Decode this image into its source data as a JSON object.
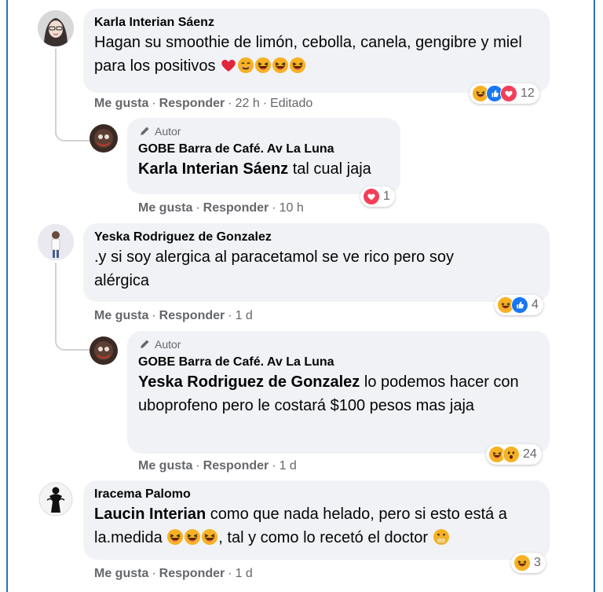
{
  "comments": [
    {
      "author": "Karla Interian Sáenz",
      "text": "Hagan su smoothie de limón, cebolla, canela, gengibre y miel para los positivos",
      "emojis": [
        "red-heart",
        "smiling-face",
        "laughing-face",
        "laughing-face",
        "laughing-face"
      ],
      "like": "Me gusta",
      "reply": "Responder",
      "time": "22 h",
      "edited": "Editado",
      "reaction_count": "12",
      "reactions": [
        "haha",
        "like",
        "love"
      ]
    },
    {
      "badge": "Autor",
      "author": "GOBE Barra de Café. Av La Luna",
      "mention": "Karla Interian Sáenz",
      "text": " tal cual jaja",
      "like": "Me gusta",
      "reply": "Responder",
      "time": "10 h",
      "reaction_count": "1",
      "reactions": [
        "love"
      ]
    },
    {
      "author": "Yeska Rodriguez de Gonzalez",
      "text": ".y si soy alergica al paracetamol se ve rico pero soy alérgica",
      "like": "Me gusta",
      "reply": "Responder",
      "time": "1 d",
      "reaction_count": "4",
      "reactions": [
        "haha",
        "like"
      ]
    },
    {
      "badge": "Autor",
      "author": "GOBE Barra de Café. Av La Luna",
      "mention": "Yeska Rodriguez de Gonzalez",
      "text": " lo podemos hacer con uboprofeno pero le costará $100 pesos mas jaja",
      "like": "Me gusta",
      "reply": "Responder",
      "time": "1 d",
      "reaction_count": "24",
      "reactions": [
        "haha",
        "wow"
      ]
    },
    {
      "author": "Iracema Palomo",
      "mention": "Laucin Interian",
      "text": " como que nada helado, pero si esto está a la.medida",
      "text2": ", tal y como lo recetó el doctor",
      "emojis": [
        "laughing-face",
        "laughing-face",
        "laughing-face"
      ],
      "end_emoji": "hand-over-mouth-face",
      "like": "Me gusta",
      "reply": "Responder",
      "time": "1 d",
      "reaction_count": "3",
      "reactions": [
        "haha"
      ]
    }
  ],
  "colors": {
    "bubble": "#f0f2f5",
    "meta": "#65676b",
    "like_blue": "#1877f2",
    "love_red": "#f33e58",
    "haha_yellow": "#f7b125",
    "frame_blue": "#2f6fb6"
  }
}
